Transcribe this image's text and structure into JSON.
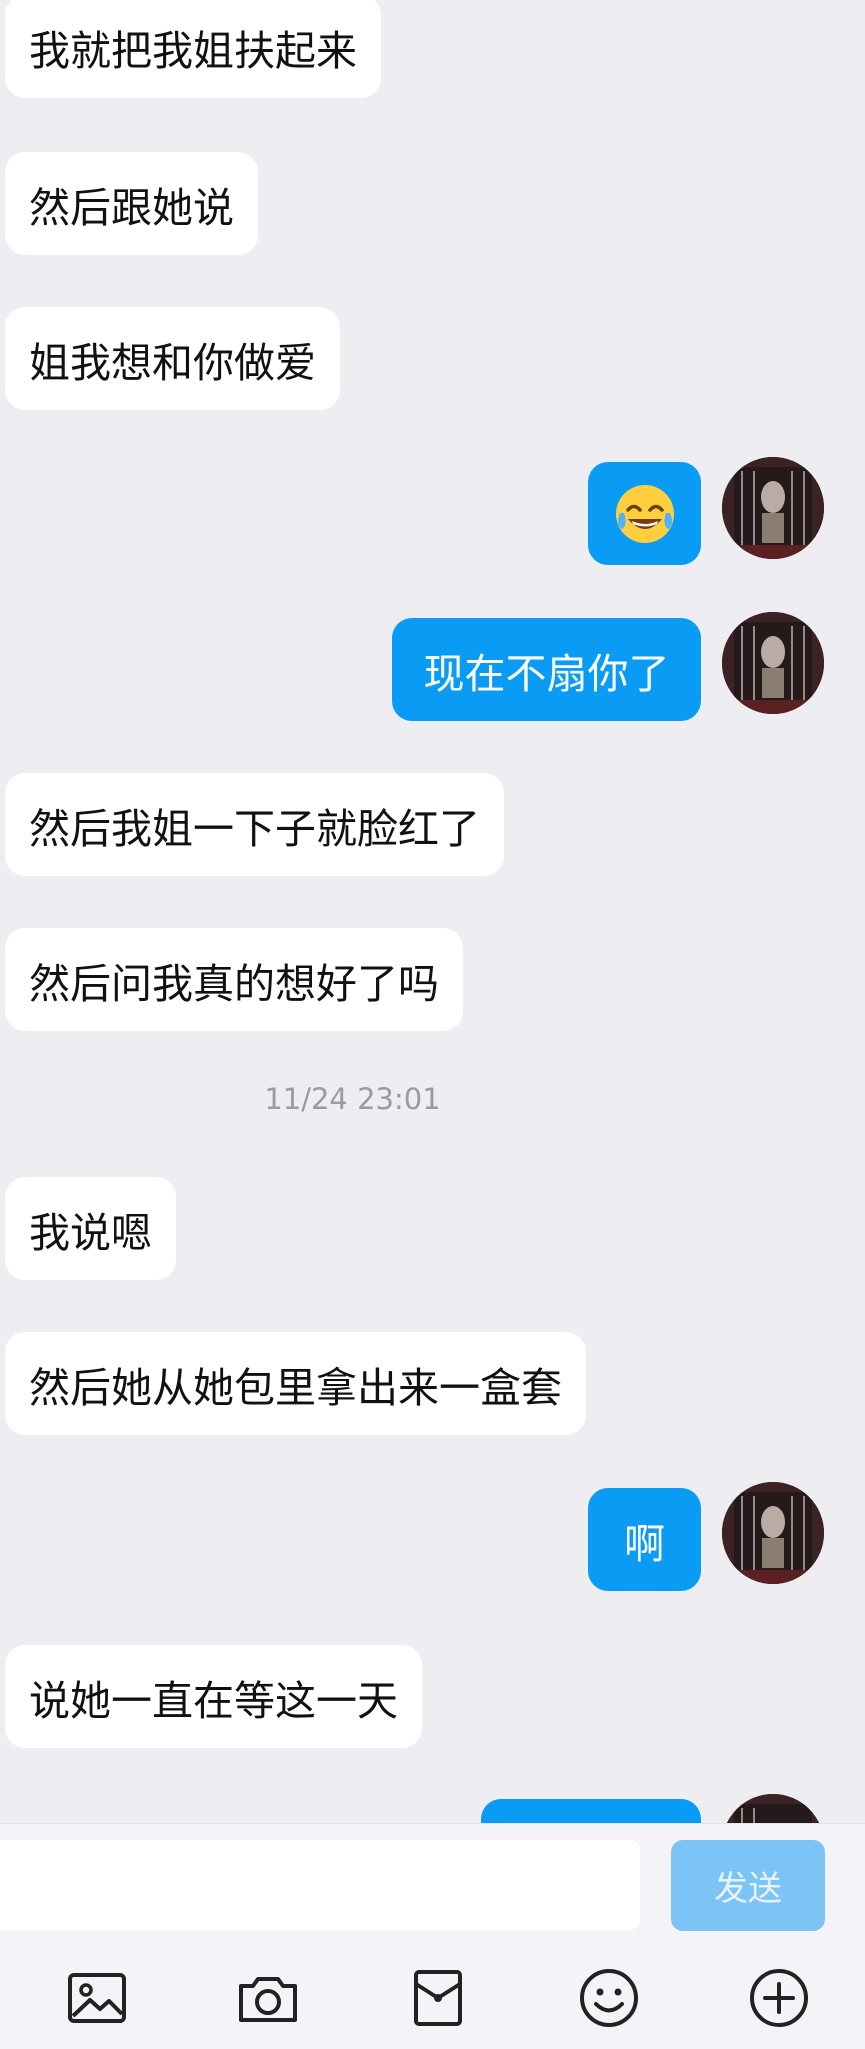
{
  "messages": [
    {
      "side": "left",
      "text": "我就把我姐扶起来"
    },
    {
      "side": "left",
      "text": "然后跟她说"
    },
    {
      "side": "left",
      "text": "姐我想和你做爱"
    },
    {
      "side": "right",
      "text": "😂",
      "emoji": "tears-of-joy-emoji"
    },
    {
      "side": "right",
      "text": "现在不扇你了"
    },
    {
      "side": "left",
      "text": "然后我姐一下子就脸红了"
    },
    {
      "side": "left",
      "text": "然后问我真的想好了吗"
    },
    {
      "side": "left",
      "text": "我说嗯"
    },
    {
      "side": "left",
      "text": "然后她从她包里拿出来一盒套"
    },
    {
      "side": "right",
      "text": "啊"
    },
    {
      "side": "left",
      "text": "说她一直在等这一天"
    }
  ],
  "timestamp": "11/24 23:01",
  "composer": {
    "input_value": "",
    "send_label": "发送"
  },
  "toolbar": {
    "icons": [
      "image-icon",
      "camera-icon",
      "red-packet-icon",
      "emoji-icon",
      "plus-icon"
    ]
  },
  "colors": {
    "background": "#ededf2",
    "incoming_bubble": "#ffffff",
    "outgoing_bubble": "#0a9cf5",
    "send_button": "#7cc4f5"
  }
}
